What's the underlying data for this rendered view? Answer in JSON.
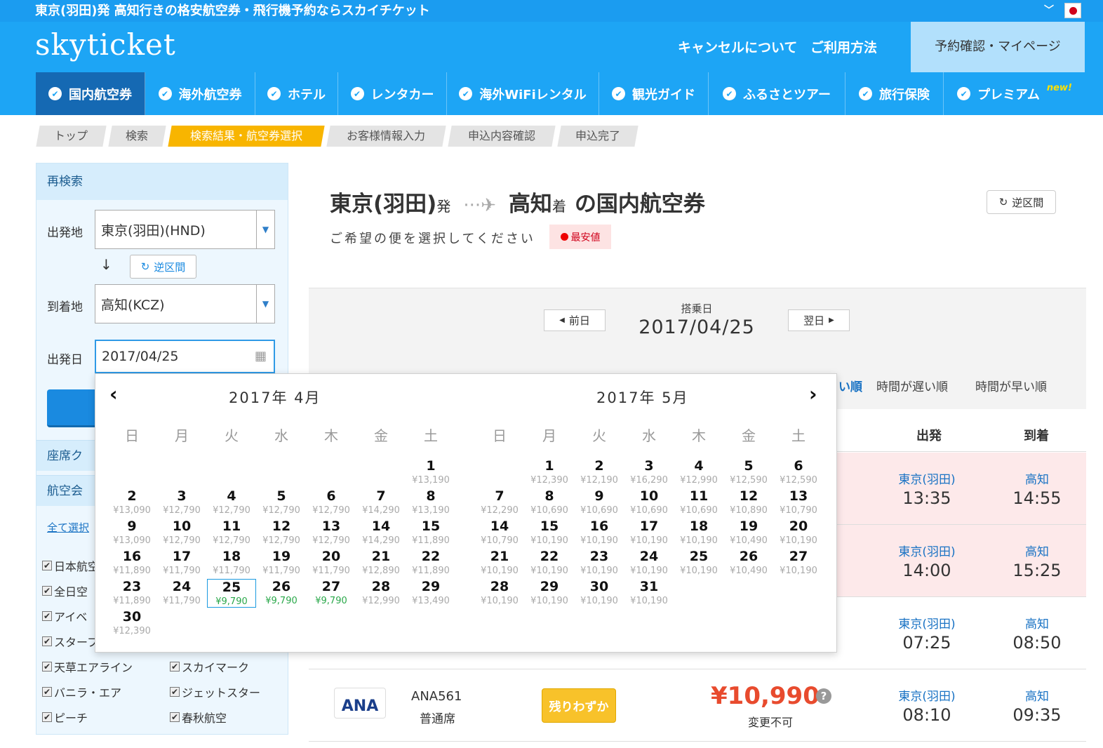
{
  "topbar": {
    "title": "東京(羽田)発 高知行きの格安航空券・飛行機予約ならスカイチケット"
  },
  "header": {
    "logo": "skyticket",
    "cancel": "キャンセルについて",
    "howto": "ご利用方法",
    "mypage": "予約確認・マイページ"
  },
  "nav": {
    "items": [
      {
        "label": "国内航空券",
        "active": true
      },
      {
        "label": "海外航空券"
      },
      {
        "label": "ホテル"
      },
      {
        "label": "レンタカー"
      },
      {
        "label": "海外WiFiレンタル"
      },
      {
        "label": "観光ガイド"
      },
      {
        "label": "ふるさとツアー"
      },
      {
        "label": "旅行保険"
      },
      {
        "label": "プレミアム",
        "badge": "new!"
      }
    ]
  },
  "breadcrumb": [
    "トップ",
    "検索",
    "検索結果・航空券選択",
    "お客様情報入力",
    "申込内容確認",
    "申込完了"
  ],
  "sidebar": {
    "header": "再検索",
    "from_label": "出発地",
    "from_value": "東京(羽田)(HND)",
    "swap": "逆区間",
    "to_label": "到着地",
    "to_value": "高知(KCZ)",
    "date_label": "出発日",
    "date_value": "2017/04/25",
    "seat_class": "座席ク",
    "airline": "航空会",
    "select_all": "全て選択",
    "airlines": [
      {
        "name": "日本航空"
      },
      {
        "name": "全日空"
      },
      {
        "name": "アイベ"
      },
      {
        "name": "スターフ"
      },
      {
        "name": "天草エアライン"
      },
      {
        "name": "スカイマーク"
      },
      {
        "name": "バニラ・エア"
      },
      {
        "name": "ジェットスター"
      },
      {
        "name": "ピーチ"
      },
      {
        "name": "春秋航空"
      }
    ]
  },
  "main": {
    "from": "東京(羽田)",
    "from_suffix": "発",
    "to": "高知",
    "to_suffix": "着",
    "title_tail": "の国内航空券",
    "subtitle": "ご希望の便を選択してください",
    "cheapest": "最安値",
    "reverse": "逆区間",
    "prev": "前日",
    "next": "翌日",
    "date_label": "搭乗日",
    "date": "2017/04/25",
    "sort": {
      "partial": "い順",
      "late": "時間が遅い順",
      "early": "時間が早い順"
    },
    "col_dep": "出発",
    "col_arr": "到着",
    "rows": [
      {
        "dep_city": "東京(羽田)",
        "dep_time": "13:35",
        "arr_city": "高知",
        "arr_time": "14:55",
        "pink": true
      },
      {
        "dep_city": "東京(羽田)",
        "dep_time": "14:00",
        "arr_city": "高知",
        "arr_time": "15:25",
        "pink": true
      },
      {
        "dep_city": "東京(羽田)",
        "dep_time": "07:25",
        "arr_city": "高知",
        "arr_time": "08:50",
        "pink": false
      },
      {
        "dep_city": "東京(羽田)",
        "dep_time": "08:10",
        "arr_city": "高知",
        "arr_time": "09:35",
        "pink": false,
        "airline": "ANA",
        "flight": "ANA561",
        "seat": "普通席",
        "badge": "残りわずか",
        "price": "¥10,990",
        "note": "変更不可"
      }
    ]
  },
  "calendar": {
    "weekdays": [
      "日",
      "月",
      "火",
      "水",
      "木",
      "金",
      "土"
    ],
    "months": [
      {
        "title": "2017年 4月",
        "first_dow": 6,
        "days": [
          [
            "1",
            "¥13,190"
          ],
          [
            "2",
            "¥13,090"
          ],
          [
            "3",
            "¥12,790"
          ],
          [
            "4",
            "¥12,790"
          ],
          [
            "5",
            "¥12,790"
          ],
          [
            "6",
            "¥12,790"
          ],
          [
            "7",
            "¥14,290"
          ],
          [
            "8",
            "¥13,190"
          ],
          [
            "9",
            "¥13,090"
          ],
          [
            "10",
            "¥12,790"
          ],
          [
            "11",
            "¥12,790"
          ],
          [
            "12",
            "¥12,790"
          ],
          [
            "13",
            "¥12,790"
          ],
          [
            "14",
            "¥14,290"
          ],
          [
            "15",
            "¥11,890"
          ],
          [
            "16",
            "¥11,890"
          ],
          [
            "17",
            "¥11,790"
          ],
          [
            "18",
            "¥11,790"
          ],
          [
            "19",
            "¥11,790"
          ],
          [
            "20",
            "¥11,790"
          ],
          [
            "21",
            "¥12,890"
          ],
          [
            "22",
            "¥11,890"
          ],
          [
            "23",
            "¥11,890"
          ],
          [
            "24",
            "¥11,790"
          ],
          [
            "25",
            "¥9,790"
          ],
          [
            "26",
            "¥9,790"
          ],
          [
            "27",
            "¥9,790"
          ],
          [
            "28",
            "¥12,990"
          ],
          [
            "29",
            "¥13,490"
          ],
          [
            "30",
            "¥12,390"
          ]
        ],
        "low": [
          25,
          26,
          27
        ],
        "selected": 25
      },
      {
        "title": "2017年 5月",
        "first_dow": 1,
        "days": [
          [
            "1",
            "¥12,390"
          ],
          [
            "2",
            "¥12,190"
          ],
          [
            "3",
            "¥16,290"
          ],
          [
            "4",
            "¥12,990"
          ],
          [
            "5",
            "¥12,590"
          ],
          [
            "6",
            "¥12,590"
          ],
          [
            "7",
            "¥12,290"
          ],
          [
            "8",
            "¥10,690"
          ],
          [
            "9",
            "¥10,690"
          ],
          [
            "10",
            "¥10,690"
          ],
          [
            "11",
            "¥10,690"
          ],
          [
            "12",
            "¥10,890"
          ],
          [
            "13",
            "¥10,790"
          ],
          [
            "14",
            "¥10,790"
          ],
          [
            "15",
            "¥10,190"
          ],
          [
            "16",
            "¥10,190"
          ],
          [
            "17",
            "¥10,190"
          ],
          [
            "18",
            "¥10,190"
          ],
          [
            "19",
            "¥10,490"
          ],
          [
            "20",
            "¥10,190"
          ],
          [
            "21",
            "¥10,190"
          ],
          [
            "22",
            "¥10,190"
          ],
          [
            "23",
            "¥10,190"
          ],
          [
            "24",
            "¥10,190"
          ],
          [
            "25",
            "¥10,190"
          ],
          [
            "26",
            "¥10,490"
          ],
          [
            "27",
            "¥10,190"
          ],
          [
            "28",
            "¥10,190"
          ],
          [
            "29",
            "¥10,190"
          ],
          [
            "30",
            "¥10,190"
          ],
          [
            "31",
            "¥10,190"
          ]
        ],
        "low": [],
        "selected": null
      }
    ]
  }
}
